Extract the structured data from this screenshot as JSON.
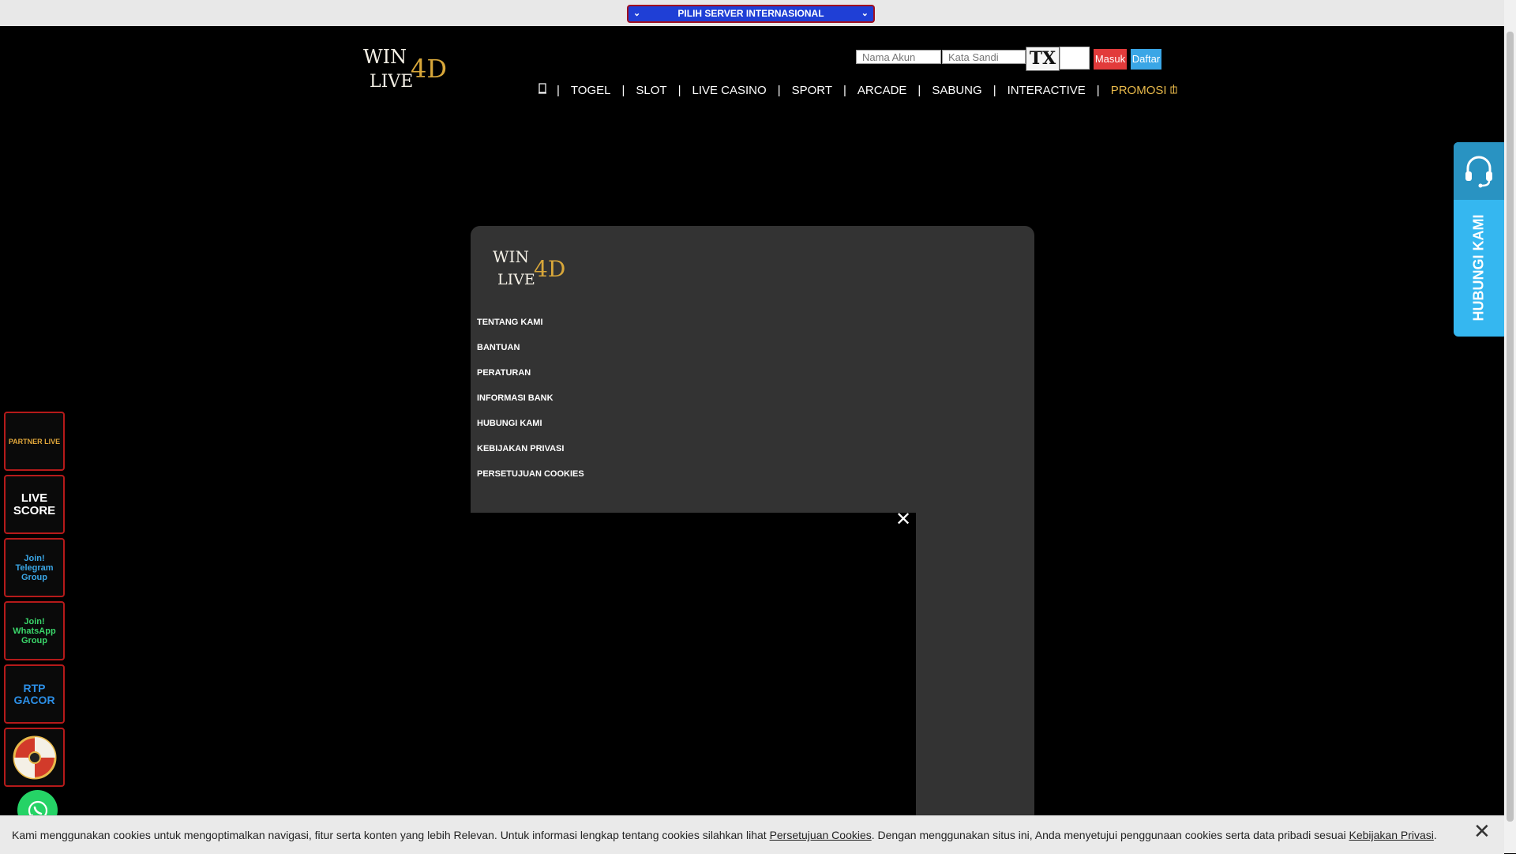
{
  "server_bar": {
    "label": "PILIH SERVER INTERNASIONAL"
  },
  "brand": {
    "logo_text_a": "WIN",
    "logo_text_b": "LIVE",
    "logo_text_c": "4D",
    "gold": "#d8a73a"
  },
  "login": {
    "username_placeholder": "Nama Akun",
    "password_placeholder": "Kata Sandi",
    "captcha_text": "TX",
    "masuk_label": "Masuk",
    "daftar_label": "Daftar"
  },
  "nav": {
    "home_icon": "home-icon",
    "items": [
      "TOGEL",
      "SLOT",
      "LIVE CASINO",
      "SPORT",
      "ARCADE",
      "SABUNG",
      "INTERACTIVE",
      "PROMOSI"
    ],
    "separator": "|"
  },
  "footer": {
    "links": [
      "TENTANG KAMI",
      "BANTUAN",
      "PERATURAN",
      "INFORMASI BANK",
      "HUBUNGI KAMI",
      "KEBIJAKAN PRIVASI",
      "PERSETUJUAN COOKIES"
    ]
  },
  "contact_tab": {
    "label": "HUBUNGI KAMI",
    "icon": "headset-icon"
  },
  "side_banners": [
    {
      "label": "PARTNER LIVE",
      "color": "#e0a63a"
    },
    {
      "label": "LIVE SCORE",
      "color": "#ffffff"
    },
    {
      "label": "Join! Telegram Group",
      "color": "#3aa6e6"
    },
    {
      "label": "Join! WhatsApp Group",
      "color": "#3ad66a"
    },
    {
      "label": "RTP GACOR",
      "color": "#2c8fe6"
    },
    {
      "label": "Spin",
      "color": "#d23a2a"
    }
  ],
  "cookie_bar": {
    "text_1": "Kami menggunakan cookies untuk mengoptimalkan navigasi, fitur serta konten yang lebih Relevan. Untuk informasi lengkap tentang cookies silahkan lihat ",
    "link_1": "Persetujuan Cookies",
    "text_2": ". Dengan menggunakan situs ini, Anda menyetujui penggunaan cookies serta data pribadi sesuai ",
    "link_2": "Kebijakan Privasi",
    "text_3": "."
  }
}
